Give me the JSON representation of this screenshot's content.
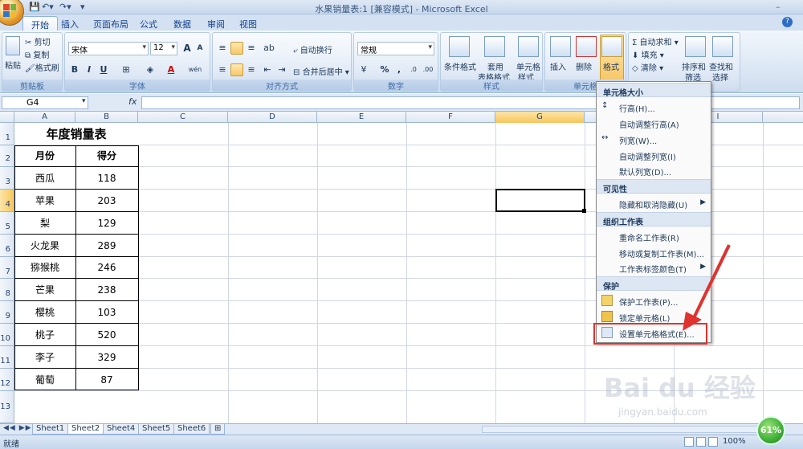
{
  "title_bar": {
    "title": "水果销量表:1  [兼容模式] - Microsoft Excel",
    "help": "?"
  },
  "tabs": [
    "开始",
    "插入",
    "页面布局",
    "公式",
    "数据",
    "审阅",
    "视图"
  ],
  "ribbon": {
    "clipboard": {
      "paste": "粘贴",
      "cut": "剪切",
      "copy": "复制",
      "format_painter": "格式刷",
      "label": "剪贴板"
    },
    "font": {
      "name": "宋体",
      "size": "12",
      "label": "字体",
      "bold": "B",
      "italic": "I",
      "underline": "U",
      "grow": "A",
      "shrink": "A",
      "wen": "wén"
    },
    "alignment": {
      "wrap": "自动换行",
      "merge": "合并后居中",
      "label": "对齐方式"
    },
    "number": {
      "format": "常规",
      "percent": "%",
      "comma": ",",
      "label": "数字"
    },
    "styles": {
      "conditional": "条件格式",
      "table": "套用",
      "table2": "表格格式",
      "cell_style": "单元格",
      "cell_style2": "样式",
      "label": "样式"
    },
    "cells": {
      "insert": "插入",
      "delete": "删除",
      "format": "格式",
      "label": "单元格"
    },
    "editing": {
      "autosum": "自动求和",
      "fill": "填充",
      "clear": "清除",
      "sort": "排序和",
      "sort2": "筛选",
      "find": "查找和",
      "find2": "选择"
    }
  },
  "formula_bar": {
    "name_box": "G4",
    "fx": "fx"
  },
  "columns": [
    "A",
    "B",
    "C",
    "D",
    "E",
    "F",
    "G",
    "H",
    "I"
  ],
  "rows": [
    "1",
    "2",
    "3",
    "4",
    "5",
    "6",
    "7",
    "8",
    "9",
    "10",
    "11",
    "12",
    "13"
  ],
  "sheet": {
    "title": "年度销量表",
    "header": [
      "月份",
      "得分"
    ],
    "data": [
      [
        "西瓜",
        "118"
      ],
      [
        "苹果",
        "203"
      ],
      [
        "梨",
        "129"
      ],
      [
        "火龙果",
        "289"
      ],
      [
        "猕猴桃",
        "246"
      ],
      [
        "芒果",
        "238"
      ],
      [
        "樱桃",
        "103"
      ],
      [
        "桃子",
        "520"
      ],
      [
        "李子",
        "329"
      ],
      [
        "葡萄",
        "87"
      ]
    ]
  },
  "menu": {
    "sections": [
      {
        "header": "单元格大小",
        "items": [
          {
            "label": "行高(H)..."
          },
          {
            "label": "自动调整行高(A)"
          },
          {
            "label": "列宽(W)..."
          },
          {
            "label": "自动调整列宽(I)"
          },
          {
            "label": "默认列宽(D)..."
          }
        ]
      },
      {
        "header": "可见性",
        "items": [
          {
            "label": "隐藏和取消隐藏(U)"
          }
        ]
      },
      {
        "header": "组织工作表",
        "items": [
          {
            "label": "重命名工作表(R)"
          },
          {
            "label": "移动或复制工作表(M)..."
          },
          {
            "label": "工作表标签颜色(T)"
          }
        ]
      },
      {
        "header": "保护",
        "items": [
          {
            "label": "保护工作表(P)..."
          },
          {
            "label": "锁定单元格(L)"
          },
          {
            "label": "设置单元格格式(E)..."
          }
        ]
      }
    ]
  },
  "sheet_tabs": [
    "Sheet1",
    "Sheet2",
    "Sheet4",
    "Sheet5",
    "Sheet6"
  ],
  "status": {
    "ready": "就绪",
    "zoom": "100%",
    "badge": "61%"
  },
  "watermark": {
    "brand": "Bai du 经验",
    "url": "jingyan.baidu.com"
  },
  "colors": {
    "accent": "#15428b",
    "arrow": "#e0322e",
    "highlight": "#f8c768"
  }
}
